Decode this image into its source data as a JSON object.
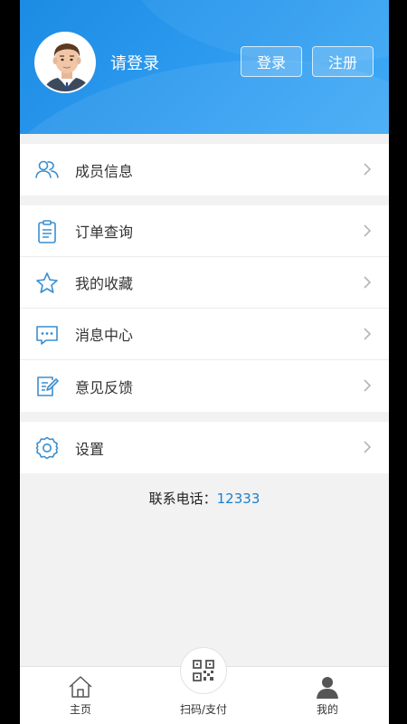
{
  "header": {
    "login_prompt": "请登录",
    "login_button": "登录",
    "register_button": "注册"
  },
  "menu": {
    "group1": [
      {
        "label": "成员信息",
        "icon": "members-icon"
      }
    ],
    "group2": [
      {
        "label": "订单查询",
        "icon": "clipboard-icon"
      },
      {
        "label": "我的收藏",
        "icon": "star-icon"
      },
      {
        "label": "消息中心",
        "icon": "message-icon"
      },
      {
        "label": "意见反馈",
        "icon": "feedback-icon"
      }
    ],
    "group3": [
      {
        "label": "设置",
        "icon": "gear-icon"
      }
    ]
  },
  "contact": {
    "label": "联系电话：",
    "phone": "12333"
  },
  "tabbar": {
    "home": "主页",
    "scan": "扫码/支付",
    "mine": "我的"
  },
  "colors": {
    "accent": "#2e9cf0",
    "icon": "#3a8fd0",
    "phone": "#1a7fd0"
  }
}
